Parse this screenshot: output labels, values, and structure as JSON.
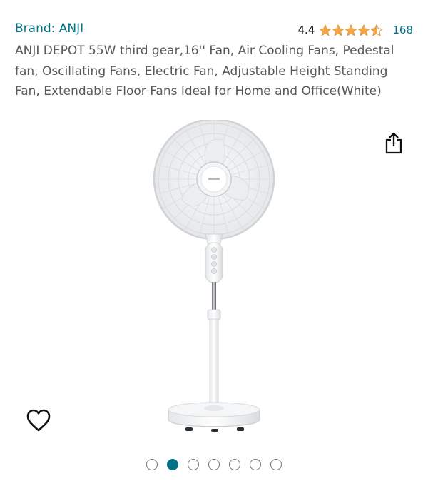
{
  "product": {
    "brand_label": "Brand: ANJI",
    "rating_value": "4.4",
    "stars": 4.4,
    "star_color": "#f3a847",
    "rating_count": "168",
    "title": "ANJI DEPOT 55W third gear,16'' Fan, Air Cooling Fans, Pedestal fan, Oscillating Fans, Electric Fan, Adjustable Height Standing Fan, Extendable Floor Fans Ideal for Home and Office(White)"
  },
  "icons": {
    "share": "share-icon",
    "wishlist": "heart-icon"
  },
  "gallery": {
    "total_images": 7,
    "active_index": 1,
    "active_color": "#007185"
  },
  "colors": {
    "link": "#007185",
    "text": "#565959"
  }
}
